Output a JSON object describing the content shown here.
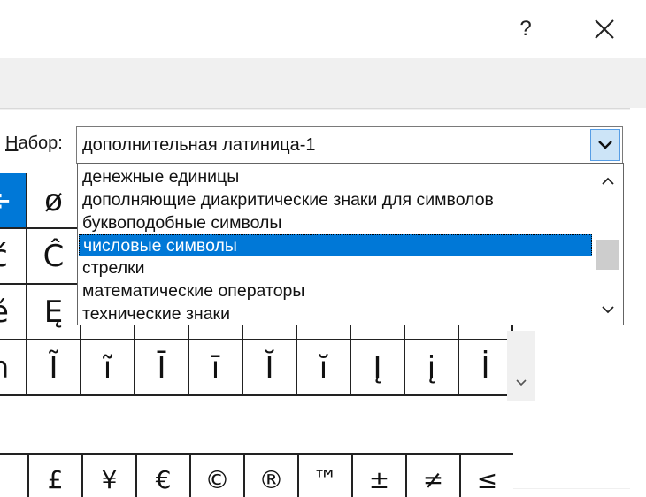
{
  "window": {
    "help_label": "?",
    "close_icon": "close-icon"
  },
  "subset": {
    "label_prefix": "",
    "label_accel": "Н",
    "label_rest": "абор:",
    "selected": "дополнительная латиница-1"
  },
  "dropdown": {
    "items": [
      "денежные единицы",
      "дополняющие диакритические знаки для символов",
      "буквоподобные символы",
      "числовые символы",
      "стрелки",
      "математические операторы",
      "технические знаки"
    ],
    "highlighted_index": 3
  },
  "grid": {
    "rows": [
      [
        "÷",
        "ø",
        "",
        "",
        "",
        "",
        "",
        "",
        "",
        ""
      ],
      [
        "ć",
        "Ĉ",
        "",
        "",
        "",
        "",
        "",
        "",
        "",
        ""
      ],
      [
        "ě",
        "Ę",
        "",
        "",
        "",
        "",
        "",
        "",
        "",
        ""
      ],
      [
        "ĥ",
        "Ĩ",
        "ĩ",
        "Ī",
        "ī",
        "Ĭ",
        "ĭ",
        "Į",
        "į",
        "İ"
      ]
    ]
  },
  "recent": {
    "symbols": [
      "",
      "£",
      "¥",
      "€",
      "©",
      "®",
      "™",
      "±",
      "≠",
      "≤"
    ]
  }
}
